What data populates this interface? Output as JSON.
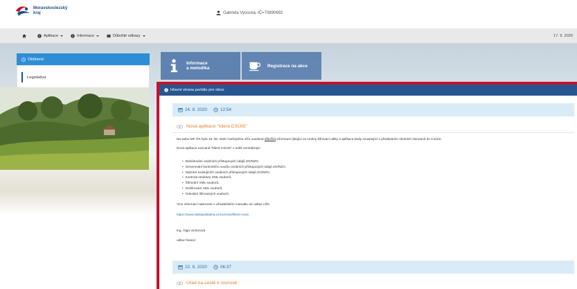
{
  "header": {
    "logo_line1": "Moravskoslezský",
    "logo_line2": "kraj",
    "user_text": "Gabriela Vysocká, IČ=70890692"
  },
  "menu": {
    "items": [
      {
        "label": "Aplikace",
        "icon": "info-circle-icon"
      },
      {
        "label": "Informace",
        "icon": "info-circle-icon"
      },
      {
        "label": "Důležité odkazy",
        "icon": "book-icon"
      }
    ],
    "date": "17. 9. 2020"
  },
  "favorites": {
    "title": "Oblíbené",
    "items": [
      "Legislativa"
    ]
  },
  "tiles": {
    "info_line1": "Informace",
    "info_line2": "a metodika",
    "registration": "Registrace na akce"
  },
  "main": {
    "title": "Hlavní strana portálu pro obce",
    "articles": [
      {
        "date": "24. 8. 2020",
        "time": "12:54",
        "title": "Nová aplikace \"klient CSÚIS\"",
        "intro_before": "Na webu MF ČR byla 19. 08. 2020 zveřejněna níže uvedená ",
        "intro_underlined": "důležitá",
        "intro_after": " informace týkající se změny šifrovací utility a aplikace Daily související s předáváním účetních záznamů do CSÚIS.",
        "lead": "Nová aplikace nazvaná \"klient CSÚIS\" v sobě centralizuje:",
        "bullets": [
          "Dekódování osobních přístupových údajů ZO/NZO,",
          "Generování kontrolního součtu osobních přístupových údajů ZO/NZO,",
          "Nahrání existujících osobních přístupových údajů ZO/NZO,",
          "Kontrola struktury XML souborů,",
          "Šifrování XML souborů,",
          "Dešifrování XML souborů,",
          "Odeslání šifrovaných souborů."
        ],
        "more": "Více informací naleznete v uživatelském manuálu viz odkaz níže.",
        "link": "https://www.statnipokladna.cz/cs/csuis/klient-csuis",
        "signature_name": "Ing. Olga Vicherová",
        "signature_dept": "odbor financí"
      },
      {
        "date": "22. 6. 2020",
        "time": "06:37",
        "title": "Úřad na cestě k rovnosti"
      }
    ]
  },
  "colors": {
    "accent_blue": "#2d8ed6",
    "header_navy": "#27568f",
    "frame_red": "#c8102e",
    "title_orange": "#e07b2a"
  }
}
